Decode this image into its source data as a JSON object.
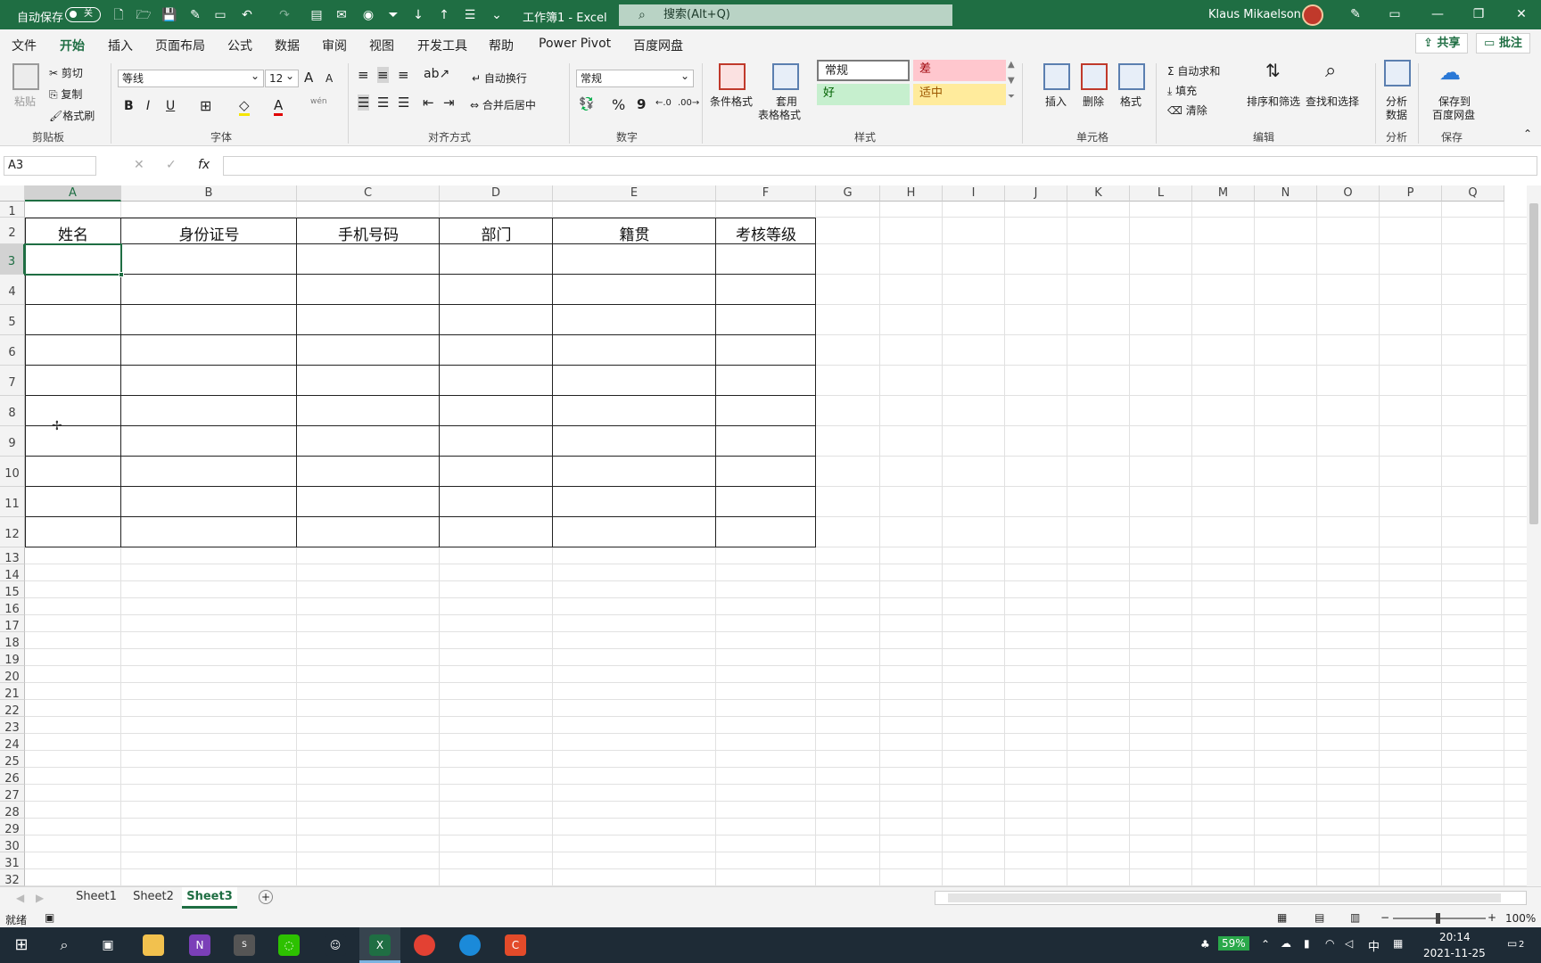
{
  "titlebar": {
    "autosave_label": "自动保存",
    "autosave_state": "关",
    "doc_title": "工作簿1 - Excel",
    "search_placeholder": "搜索(Alt+Q)",
    "user_name": "Klaus Mikaelson"
  },
  "menu": {
    "tabs": [
      "文件",
      "开始",
      "插入",
      "页面布局",
      "公式",
      "数据",
      "审阅",
      "视图",
      "开发工具",
      "帮助",
      "Power Pivot",
      "百度网盘"
    ],
    "active_tab": "开始",
    "share_label": "共享",
    "comments_label": "批注"
  },
  "ribbon": {
    "clipboard": {
      "paste": "粘贴",
      "cut": "剪切",
      "copy": "复制",
      "format_painter": "格式刷",
      "group": "剪贴板"
    },
    "font": {
      "font_name": "等线",
      "font_size": "12",
      "bold": "B",
      "italic": "I",
      "underline": "U",
      "grow": "A",
      "shrink": "A",
      "phonetic": "wén",
      "group": "字体"
    },
    "alignment": {
      "wrap": "自动换行",
      "merge": "合并后居中",
      "group": "对齐方式"
    },
    "number": {
      "format": "常规",
      "percent": "%",
      "comma": "9",
      "group": "数字"
    },
    "styles": {
      "cond_format": "条件格式",
      "table_format_1": "套用",
      "table_format_2": "表格格式",
      "normal": "常规",
      "bad": "差",
      "good": "好",
      "neutral": "适中",
      "group": "样式"
    },
    "cells": {
      "insert": "插入",
      "delete": "删除",
      "format": "格式",
      "group": "单元格"
    },
    "editing": {
      "autosum": "自动求和",
      "fill": "填充",
      "clear": "清除",
      "sort": "排序和筛选",
      "find": "查找和选择",
      "group": "编辑"
    },
    "analysis": {
      "analyze_1": "分析",
      "analyze_2": "数据",
      "group": "分析"
    },
    "save": {
      "save_1": "保存到",
      "save_2": "百度网盘",
      "group": "保存"
    }
  },
  "formula_bar": {
    "name_box": "A3",
    "fx": "fx",
    "cancel": "✕",
    "enter": "✓",
    "content": ""
  },
  "sheet": {
    "columns": [
      "A",
      "B",
      "C",
      "D",
      "E",
      "F",
      "G",
      "H",
      "I",
      "J",
      "K",
      "L",
      "M",
      "N",
      "O",
      "P",
      "Q"
    ],
    "rows": [
      "1",
      "2",
      "3",
      "4",
      "5",
      "6",
      "7",
      "8",
      "9",
      "10",
      "11",
      "12",
      "13",
      "14",
      "15",
      "16",
      "17",
      "18",
      "19",
      "20",
      "21",
      "22",
      "23",
      "24",
      "25",
      "26",
      "27",
      "28",
      "29",
      "30",
      "31",
      "32"
    ],
    "header_row": [
      "姓名",
      "身份证号",
      "手机号码",
      "部门",
      "籍贯",
      "考核等级"
    ],
    "selected_cell": "A3"
  },
  "sheet_tabs": {
    "tabs": [
      "Sheet1",
      "Sheet2",
      "Sheet3"
    ],
    "active": "Sheet3",
    "add": "+"
  },
  "statusbar": {
    "ready": "就绪",
    "zoom": "100%"
  },
  "taskbar": {
    "battery": "59%",
    "ime": "中",
    "time": "20:14",
    "date": "2021-11-25",
    "notif": "2"
  }
}
